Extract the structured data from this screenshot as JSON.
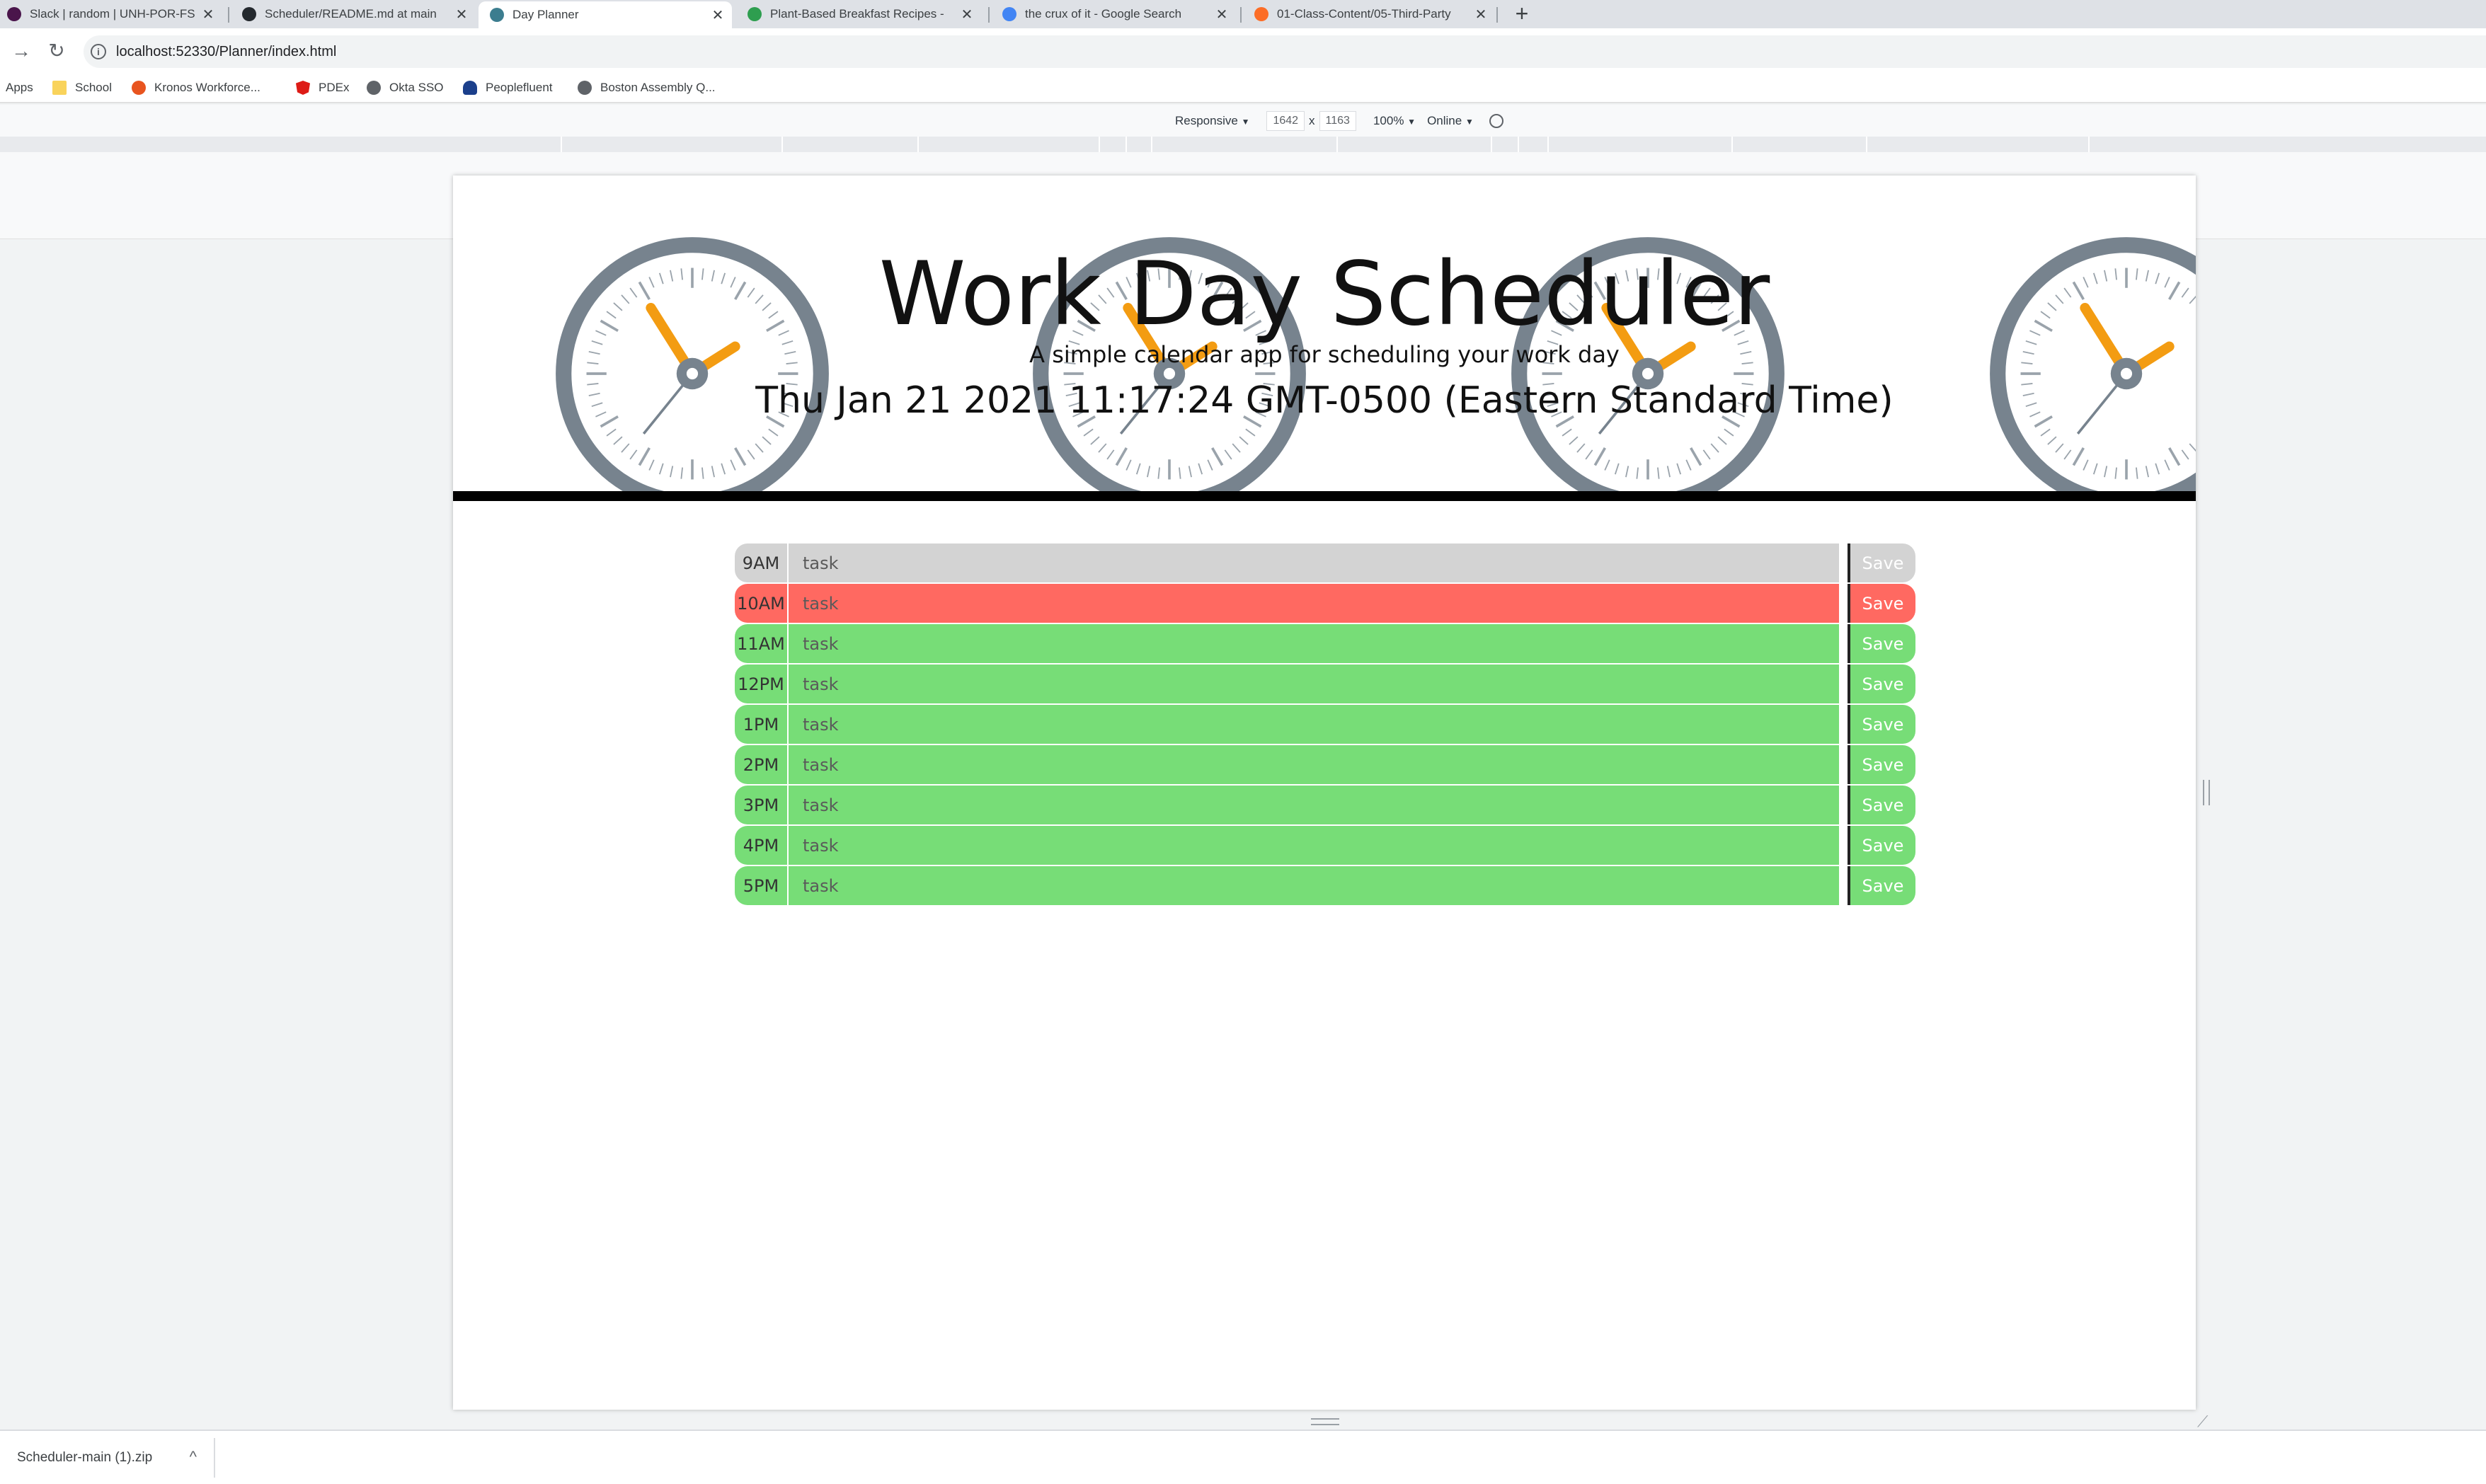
{
  "browser": {
    "tabs": [
      {
        "title": "Slack | random | UNH-POR-FSF-F",
        "icon_color": "#4a154b",
        "active": false
      },
      {
        "title": "Scheduler/README.md at main",
        "icon_color": "#24292e",
        "active": false
      },
      {
        "title": "Day Planner",
        "icon_color": "#3c7d8f",
        "active": true
      },
      {
        "title": "Plant-Based Breakfast Recipes -",
        "icon_color": "#2e9e4f",
        "active": false
      },
      {
        "title": "the crux of it - Google Search",
        "icon_color": "#4285f4",
        "active": false
      },
      {
        "title": "01-Class-Content/05-Third-Party",
        "icon_color": "#fc6d26",
        "active": false
      }
    ],
    "tab_close_glyph": "✕",
    "new_tab_glyph": "+",
    "url": "localhost:52330/Planner/index.html",
    "bookmarks": [
      {
        "label": "Apps",
        "icon_color": ""
      },
      {
        "label": "School",
        "icon_color": "#f9d35b"
      },
      {
        "label": "Kronos Workforce...",
        "icon_color": "#e8541f"
      },
      {
        "label": "PDEx",
        "icon_color": "#dd1b16"
      },
      {
        "label": "Okta SSO",
        "icon_color": "#5f6368"
      },
      {
        "label": "Peoplefluent",
        "icon_color": "#1b3f8b"
      },
      {
        "label": "Boston Assembly Q...",
        "icon_color": "#5f6368"
      }
    ]
  },
  "devtools": {
    "device": "Responsive",
    "width": "1642",
    "times": "x",
    "height": "1163",
    "zoom": "100%",
    "network": "Online",
    "dropdown_glyph": "▼"
  },
  "page": {
    "title": "Work Day Scheduler",
    "lead": "A simple calendar app for scheduling your work day",
    "current_date": "Thu Jan 21 2021 11:17:24 GMT-0500 (Eastern Standard Time)",
    "placeholder": "task",
    "save_label": "Save",
    "colors": {
      "past": "#d3d3d3",
      "present": "#ff6961",
      "future": "#77dd77",
      "clock_ring": "#77838e",
      "clock_hand": "#f39c12"
    },
    "hours": [
      {
        "label": "9AM",
        "state": "past"
      },
      {
        "label": "10AM",
        "state": "present"
      },
      {
        "label": "11AM",
        "state": "future"
      },
      {
        "label": "12PM",
        "state": "future"
      },
      {
        "label": "1PM",
        "state": "future"
      },
      {
        "label": "2PM",
        "state": "future"
      },
      {
        "label": "3PM",
        "state": "future"
      },
      {
        "label": "4PM",
        "state": "future"
      },
      {
        "label": "5PM",
        "state": "future"
      }
    ]
  },
  "downloads": {
    "file": "Scheduler-main (1).zip",
    "chevron_glyph": "^"
  }
}
